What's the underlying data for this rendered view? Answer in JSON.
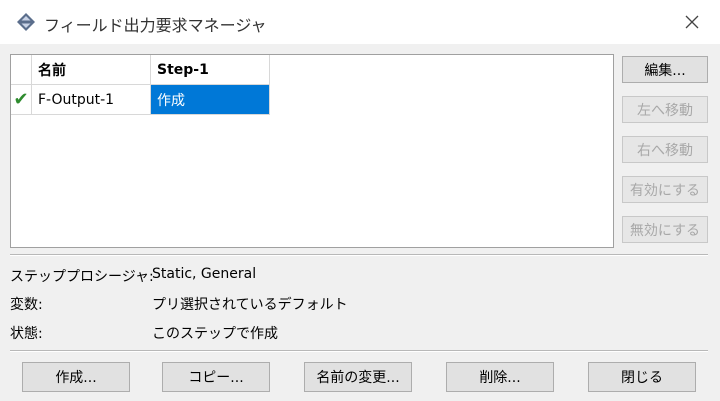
{
  "window": {
    "title": "フィールド出力要求マネージャ"
  },
  "icons": {
    "app": "abaqus-app-icon",
    "close": "close-icon",
    "check": "checkmark-icon"
  },
  "grid": {
    "headers": [
      "",
      "名前",
      "Step-1"
    ],
    "rows": [
      {
        "active": "✔",
        "name": "F-Output-1",
        "step1": "作成"
      }
    ]
  },
  "side_buttons": {
    "edit": "編集...",
    "move_left": "左へ移動",
    "move_right": "右へ移動",
    "activate": "有効にする",
    "deactivate": "無効にする"
  },
  "info": {
    "procedure_label": "ステッププロシージャ:",
    "procedure_value": "Static, General",
    "variables_label": "変数:",
    "variables_value": "プリ選択されているデフォルト",
    "status_label": "状態:",
    "status_value": "このステップで作成"
  },
  "bottom_buttons": {
    "create": "作成...",
    "copy": "コピー...",
    "rename": "名前の変更...",
    "delete": "削除...",
    "close": "閉じる"
  },
  "colors": {
    "selection": "#0078d7",
    "check": "#2e8b2e",
    "dialog_bg": "#f0f0f0"
  }
}
